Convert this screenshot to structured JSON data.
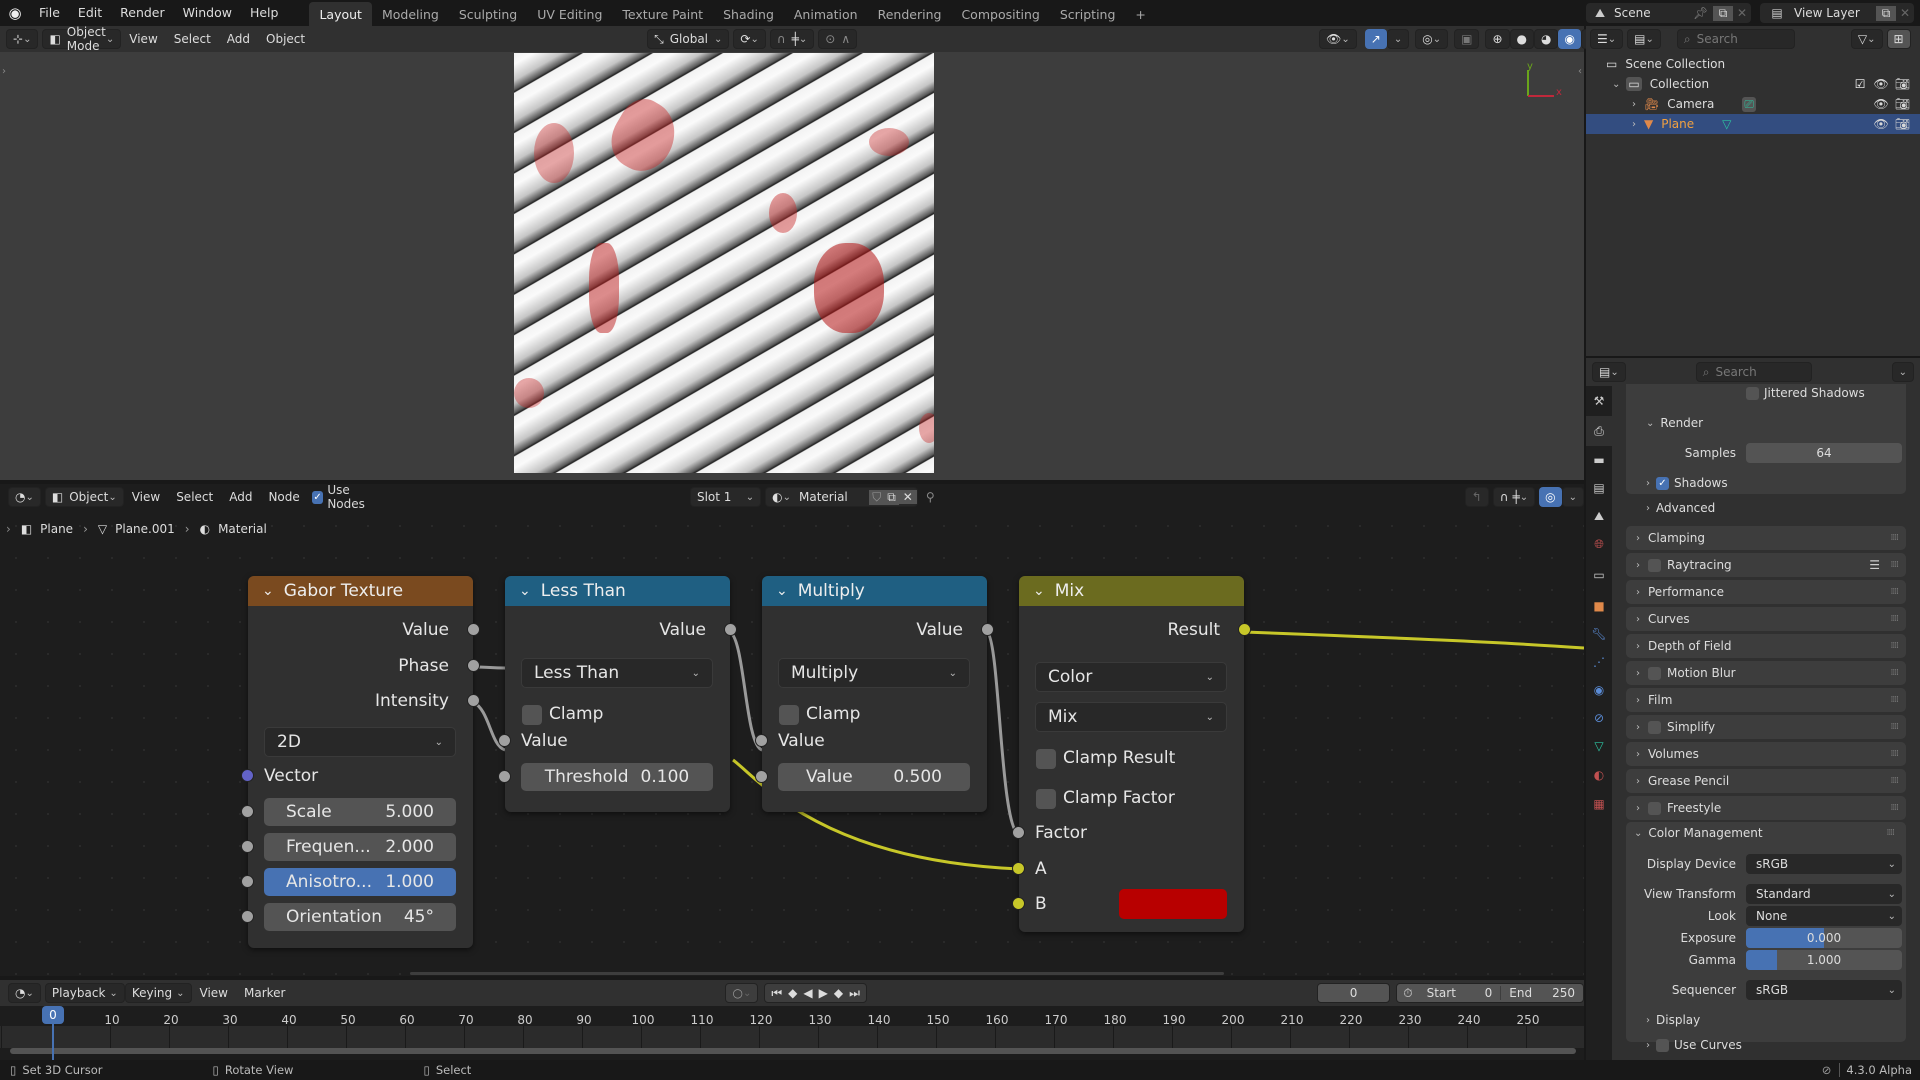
{
  "topbar": {
    "menus": [
      "File",
      "Edit",
      "Render",
      "Window",
      "Help"
    ],
    "workspaces": [
      "Layout",
      "Modeling",
      "Sculpting",
      "UV Editing",
      "Texture Paint",
      "Shading",
      "Animation",
      "Rendering",
      "Compositing",
      "Scripting"
    ],
    "active_workspace": "Layout",
    "add_tab": "+",
    "scene": "Scene",
    "view_layer": "View Layer"
  },
  "viewport_header": {
    "mode": "Object Mode",
    "menus": [
      "View",
      "Select",
      "Add",
      "Object"
    ],
    "orientation": "Global"
  },
  "axis_gizmo": {
    "y": "y",
    "x": "x"
  },
  "outliner": {
    "search_placeholder": "Search",
    "root": "Scene Collection",
    "collection": "Collection",
    "items": [
      {
        "name": "Camera",
        "selected": false
      },
      {
        "name": "Plane",
        "selected": true
      }
    ]
  },
  "properties": {
    "search_placeholder": "Search",
    "jittered_shadows": "Jittered Shadows",
    "render_section": "Render",
    "samples_label": "Samples",
    "samples_value": "64",
    "shadows": {
      "label": "Shadows",
      "checked": true
    },
    "advanced": "Advanced",
    "panels": [
      {
        "label": "Clamping",
        "checkbox": false
      },
      {
        "label": "Raytracing",
        "checkbox": true
      },
      {
        "label": "Performance",
        "checkbox": false
      },
      {
        "label": "Curves",
        "checkbox": false
      },
      {
        "label": "Depth of Field",
        "checkbox": false
      },
      {
        "label": "Motion Blur",
        "checkbox": true
      },
      {
        "label": "Film",
        "checkbox": false
      },
      {
        "label": "Simplify",
        "checkbox": true
      },
      {
        "label": "Volumes",
        "checkbox": false
      },
      {
        "label": "Grease Pencil",
        "checkbox": false
      },
      {
        "label": "Freestyle",
        "checkbox": true
      }
    ],
    "color_management": {
      "title": "Color Management",
      "display_device_label": "Display Device",
      "display_device": "sRGB",
      "view_transform_label": "View Transform",
      "view_transform": "Standard",
      "look_label": "Look",
      "look": "None",
      "exposure_label": "Exposure",
      "exposure": "0.000",
      "exposure_fill": 0.5,
      "gamma_label": "Gamma",
      "gamma": "1.000",
      "gamma_fill": 0.2,
      "sequencer_label": "Sequencer",
      "sequencer": "sRGB",
      "display": "Display",
      "use_curves": "Use Curves"
    }
  },
  "node_editor": {
    "header": {
      "object": "Object",
      "menus": [
        "View",
        "Select",
        "Add",
        "Node"
      ],
      "use_nodes": "Use Nodes",
      "slot": "Slot 1",
      "material": "Material"
    },
    "breadcrumb": [
      "Plane",
      "Plane.001",
      "Material"
    ],
    "nodes": {
      "gabor": {
        "title": "Gabor Texture",
        "color": "#7a4a1f",
        "outputs": [
          "Value",
          "Phase",
          "Intensity"
        ],
        "type": "2D",
        "vector": "Vector",
        "fields": [
          {
            "label": "Scale",
            "value": "5.000"
          },
          {
            "label": "Frequen...",
            "value": "2.000"
          },
          {
            "label": "Anisotro...",
            "value": "1.000"
          },
          {
            "label": "Orientation",
            "value": "45°"
          }
        ]
      },
      "less_than": {
        "title": "Less Than",
        "color": "#1f5f82",
        "output": "Value",
        "operation": "Less Than",
        "clamp": "Clamp",
        "input": "Value",
        "threshold_label": "Threshold",
        "threshold": "0.100"
      },
      "multiply": {
        "title": "Multiply",
        "color": "#1f5f82",
        "output": "Value",
        "operation": "Multiply",
        "clamp": "Clamp",
        "input": "Value",
        "value_label": "Value",
        "value": "0.500"
      },
      "mix": {
        "title": "Mix",
        "color": "#6b6b1f",
        "output": "Result",
        "data_type": "Color",
        "blend": "Mix",
        "clamp_result": "Clamp Result",
        "clamp_factor": "Clamp Factor",
        "factor": "Factor",
        "a": "A",
        "b": "B",
        "b_color": "#b80000"
      }
    }
  },
  "timeline": {
    "menus": [
      "Playback",
      "Keying",
      "View",
      "Marker"
    ],
    "current_frame": "0",
    "start_label": "Start",
    "start": "0",
    "end_label": "End",
    "end": "250",
    "ticks": [
      "0",
      "10",
      "20",
      "30",
      "40",
      "50",
      "60",
      "70",
      "80",
      "90",
      "100",
      "110",
      "120",
      "130",
      "140",
      "150",
      "160",
      "170",
      "180",
      "190",
      "200",
      "210",
      "220",
      "230",
      "240",
      "250"
    ]
  },
  "statusbar": {
    "left": "Set 3D Cursor",
    "middle": "Rotate View",
    "right": "Select",
    "version": "4.3.0 Alpha"
  }
}
